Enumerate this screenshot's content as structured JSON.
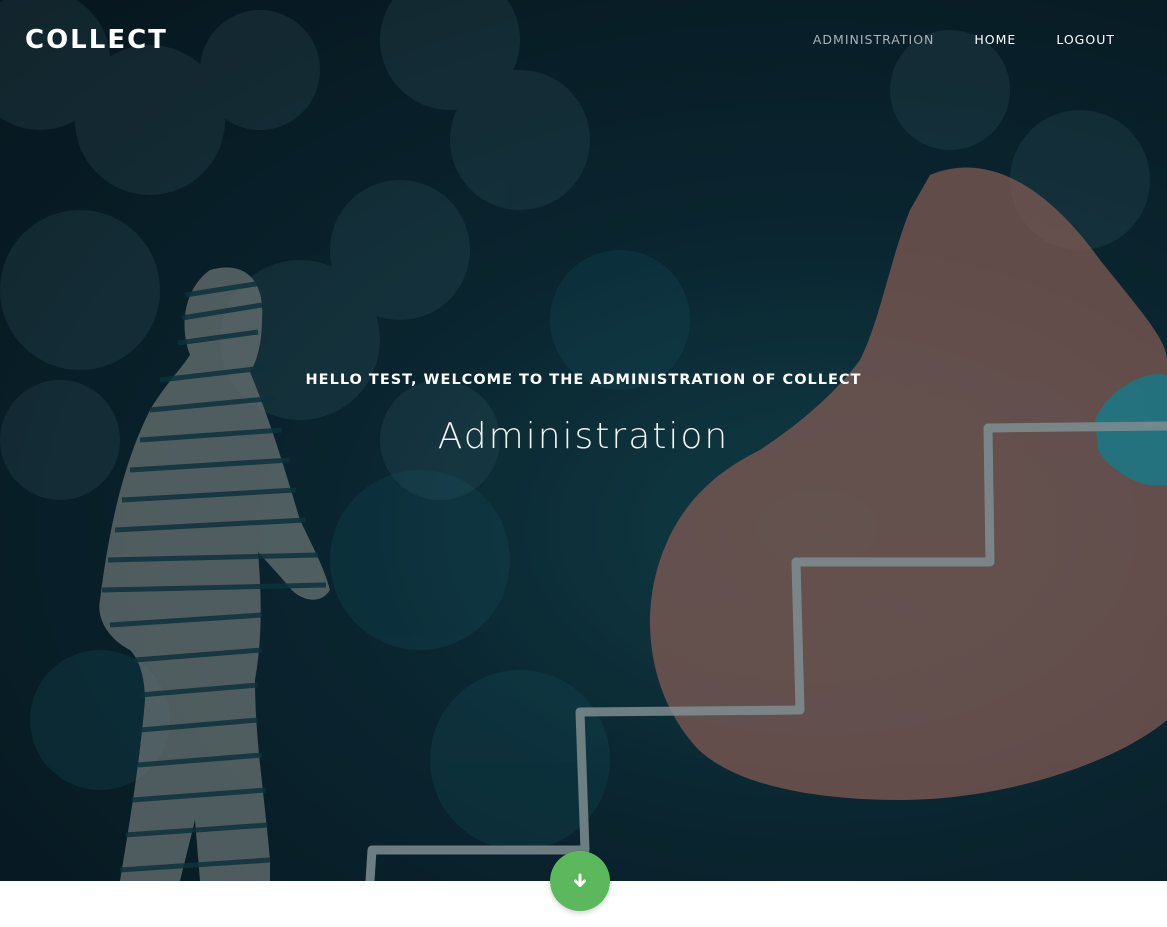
{
  "brand": {
    "name": "COLLECT"
  },
  "nav": {
    "items": [
      {
        "label": "ADMINISTRATION",
        "active": true
      },
      {
        "label": "HOME",
        "active": false
      },
      {
        "label": "LOGOUT",
        "active": false
      }
    ]
  },
  "hero": {
    "subtitle": "HELLO TEST, WELCOME TO THE ADMINISTRATION OF COLLECT",
    "title": "Administration"
  },
  "scroll_button": {
    "icon": "arrow-down-icon",
    "color": "#5cb85c"
  },
  "colors": {
    "hero_dark": "#07171f",
    "hero_teal": "#14464f",
    "nav_active": "#a7b2b8",
    "text": "#ffffff"
  }
}
